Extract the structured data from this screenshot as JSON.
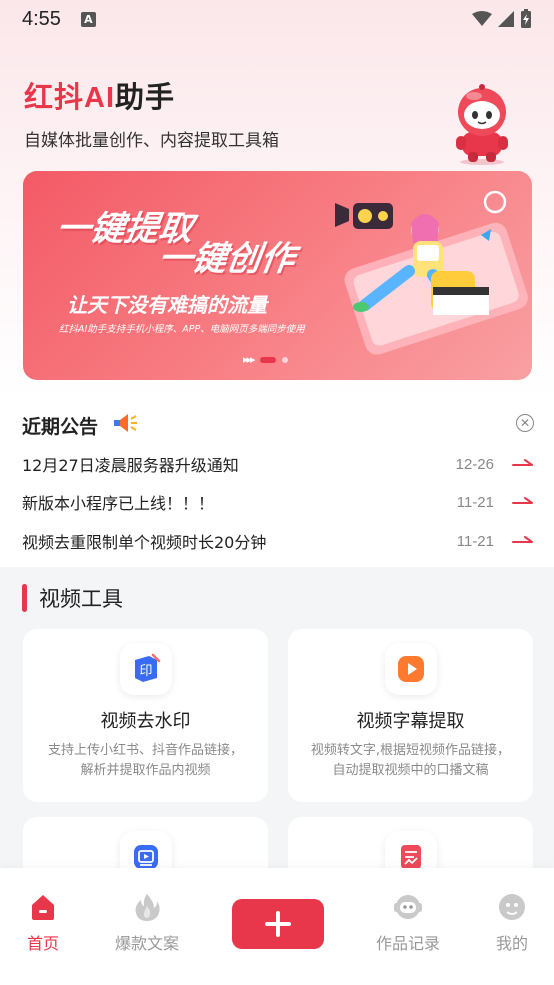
{
  "status_bar": {
    "time": "4:55",
    "notification_icon": "A"
  },
  "header": {
    "title_red": "红抖AI",
    "title_black": "助手",
    "subtitle": "自媒体批量创作、内容提取工具箱"
  },
  "banner": {
    "line1": "一键提取",
    "line2": "一键创作",
    "slogan": "让天下没有难搞的流量",
    "desc": "红抖AI助手支持手机小程序、APP、电脑网页多端同步使用",
    "arrows": "▸▸▸",
    "slide_index": 1,
    "slide_count": 2
  },
  "notice": {
    "title": "近期公告",
    "items": [
      {
        "text": "12月27日凌晨服务器升级通知",
        "date": "12-26"
      },
      {
        "text": "新版本小程序已上线！！！",
        "date": "11-21"
      },
      {
        "text": "视频去重限制单个视频时长20分钟",
        "date": "11-21"
      }
    ]
  },
  "video_tools": {
    "section_title": "视频工具",
    "cards": [
      {
        "title": "视频去水印",
        "desc_line1": "支持上传小红书、抖音作品链接，",
        "desc_line2": "解析并提取作品内视频",
        "icon": "watermark-icon"
      },
      {
        "title": "视频字幕提取",
        "desc_line1": "视频转文字,根据短视频作品链接，",
        "desc_line2": "自动提取视频中的口播文稿",
        "icon": "play-icon"
      },
      {
        "title": "",
        "desc_line1": "",
        "desc_line2": "",
        "icon": "video-edit-icon"
      },
      {
        "title": "",
        "desc_line1": "",
        "desc_line2": "",
        "icon": "document-icon"
      }
    ]
  },
  "tab_bar": {
    "items": [
      {
        "label": "首页",
        "icon": "home-icon",
        "active": true
      },
      {
        "label": "爆款文案",
        "icon": "fire-icon",
        "active": false
      },
      {
        "label": "作品记录",
        "icon": "robot-icon",
        "active": false
      },
      {
        "label": "我的",
        "icon": "profile-icon",
        "active": false
      }
    ],
    "add_icon": "plus-icon"
  },
  "colors": {
    "accent": "#e8374a",
    "inactive": "#999999",
    "subtle": "#8a8a8a"
  }
}
